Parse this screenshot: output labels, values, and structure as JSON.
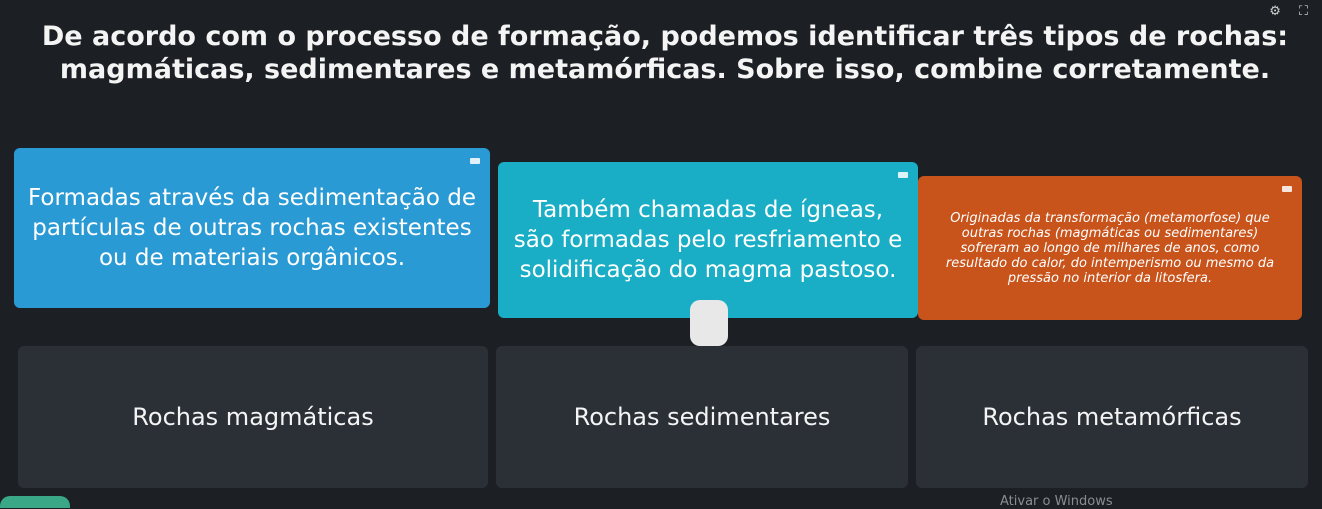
{
  "top_icons": {
    "settings_icon": "gear-icon",
    "fullscreen_icon": "fullscreen-icon"
  },
  "question": "De acordo com o processo de formação, podemos identificar três tipos de rochas: magmáticas, sedimentares e metamórficas. Sobre isso, combine corretamente.",
  "cards": [
    {
      "text": "Formadas através da sedimentação de partículas de outras rochas existentes ou de materiais orgânicos.",
      "color": "#2a9ad4"
    },
    {
      "text": "Também chamadas de ígneas, são formadas pelo resfriamento e solidificação do magma pastoso.",
      "color": "#19aec5"
    },
    {
      "text": "Originadas da transformação (metamorfose) que outras rochas (magmáticas ou sedimentares) sofreram ao longo de milhares de anos, como resultado do calor, do intemperismo ou mesmo da pressão no interior da litosfera.",
      "color": "#c8531b"
    }
  ],
  "slots": [
    {
      "label": "Rochas magmáticas"
    },
    {
      "label": "Rochas sedimentares"
    },
    {
      "label": "Rochas metamórficas"
    }
  ],
  "watermark": "Ativar o Windows"
}
